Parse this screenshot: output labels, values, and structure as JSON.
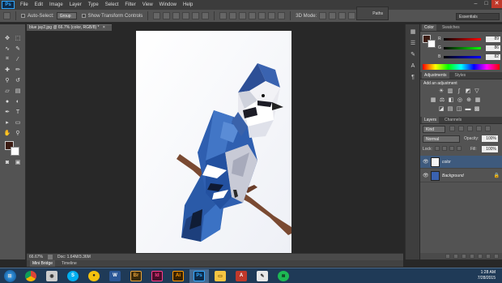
{
  "app": {
    "logo": "Ps"
  },
  "menu": [
    "File",
    "Edit",
    "Image",
    "Layer",
    "Type",
    "Select",
    "Filter",
    "View",
    "Window",
    "Help"
  ],
  "window_controls": {
    "minimize": "–",
    "maximize": "□",
    "close": "✕"
  },
  "options": {
    "auto_select_label": "Auto-Select:",
    "auto_select_value": "Group",
    "transform_label": "Show Transform Controls",
    "mode3d_label": "3D Mode:"
  },
  "workspace": {
    "path_label": "Paths",
    "essentials": "Essentials"
  },
  "document": {
    "tab": "blue jay2.jpg @ 66.7% (color, RGB/8) *",
    "close": "×"
  },
  "status": {
    "zoom": "66.67%",
    "doc": "Doc: 1.64M/3.36M"
  },
  "minibridge": {
    "items": [
      "Mini Bridge",
      "Timeline"
    ]
  },
  "color_panel": {
    "tabs": [
      "Color",
      "Swatches"
    ],
    "rows": [
      {
        "label": "R",
        "value": "89"
      },
      {
        "label": "G",
        "value": "86"
      },
      {
        "label": "B",
        "value": "82"
      }
    ]
  },
  "adjustments_panel": {
    "tabs": [
      "Adjustments",
      "Styles"
    ],
    "heading": "Add an adjustment"
  },
  "layers_panel": {
    "tabs": [
      "Layers",
      "Channels"
    ],
    "filter": "Kind",
    "blend_mode": "Normal",
    "opacity_label": "Opacity:",
    "opacity": "100%",
    "lock_label": "Lock:",
    "fill_label": "Fill:",
    "fill": "100%",
    "layers": [
      {
        "name": "color"
      },
      {
        "name": "Background"
      }
    ]
  },
  "taskbar": {
    "time": "1:28 AM",
    "date": "7/28/2015"
  },
  "icons": {
    "eye": "eye-icon",
    "lock": "lock-icon",
    "start": "windows-start-icon"
  },
  "colors": {
    "accent": "#31a8ff",
    "panel": "#535353",
    "canvas_bg": "#282828",
    "jay_blue": "#2f5fb0"
  }
}
